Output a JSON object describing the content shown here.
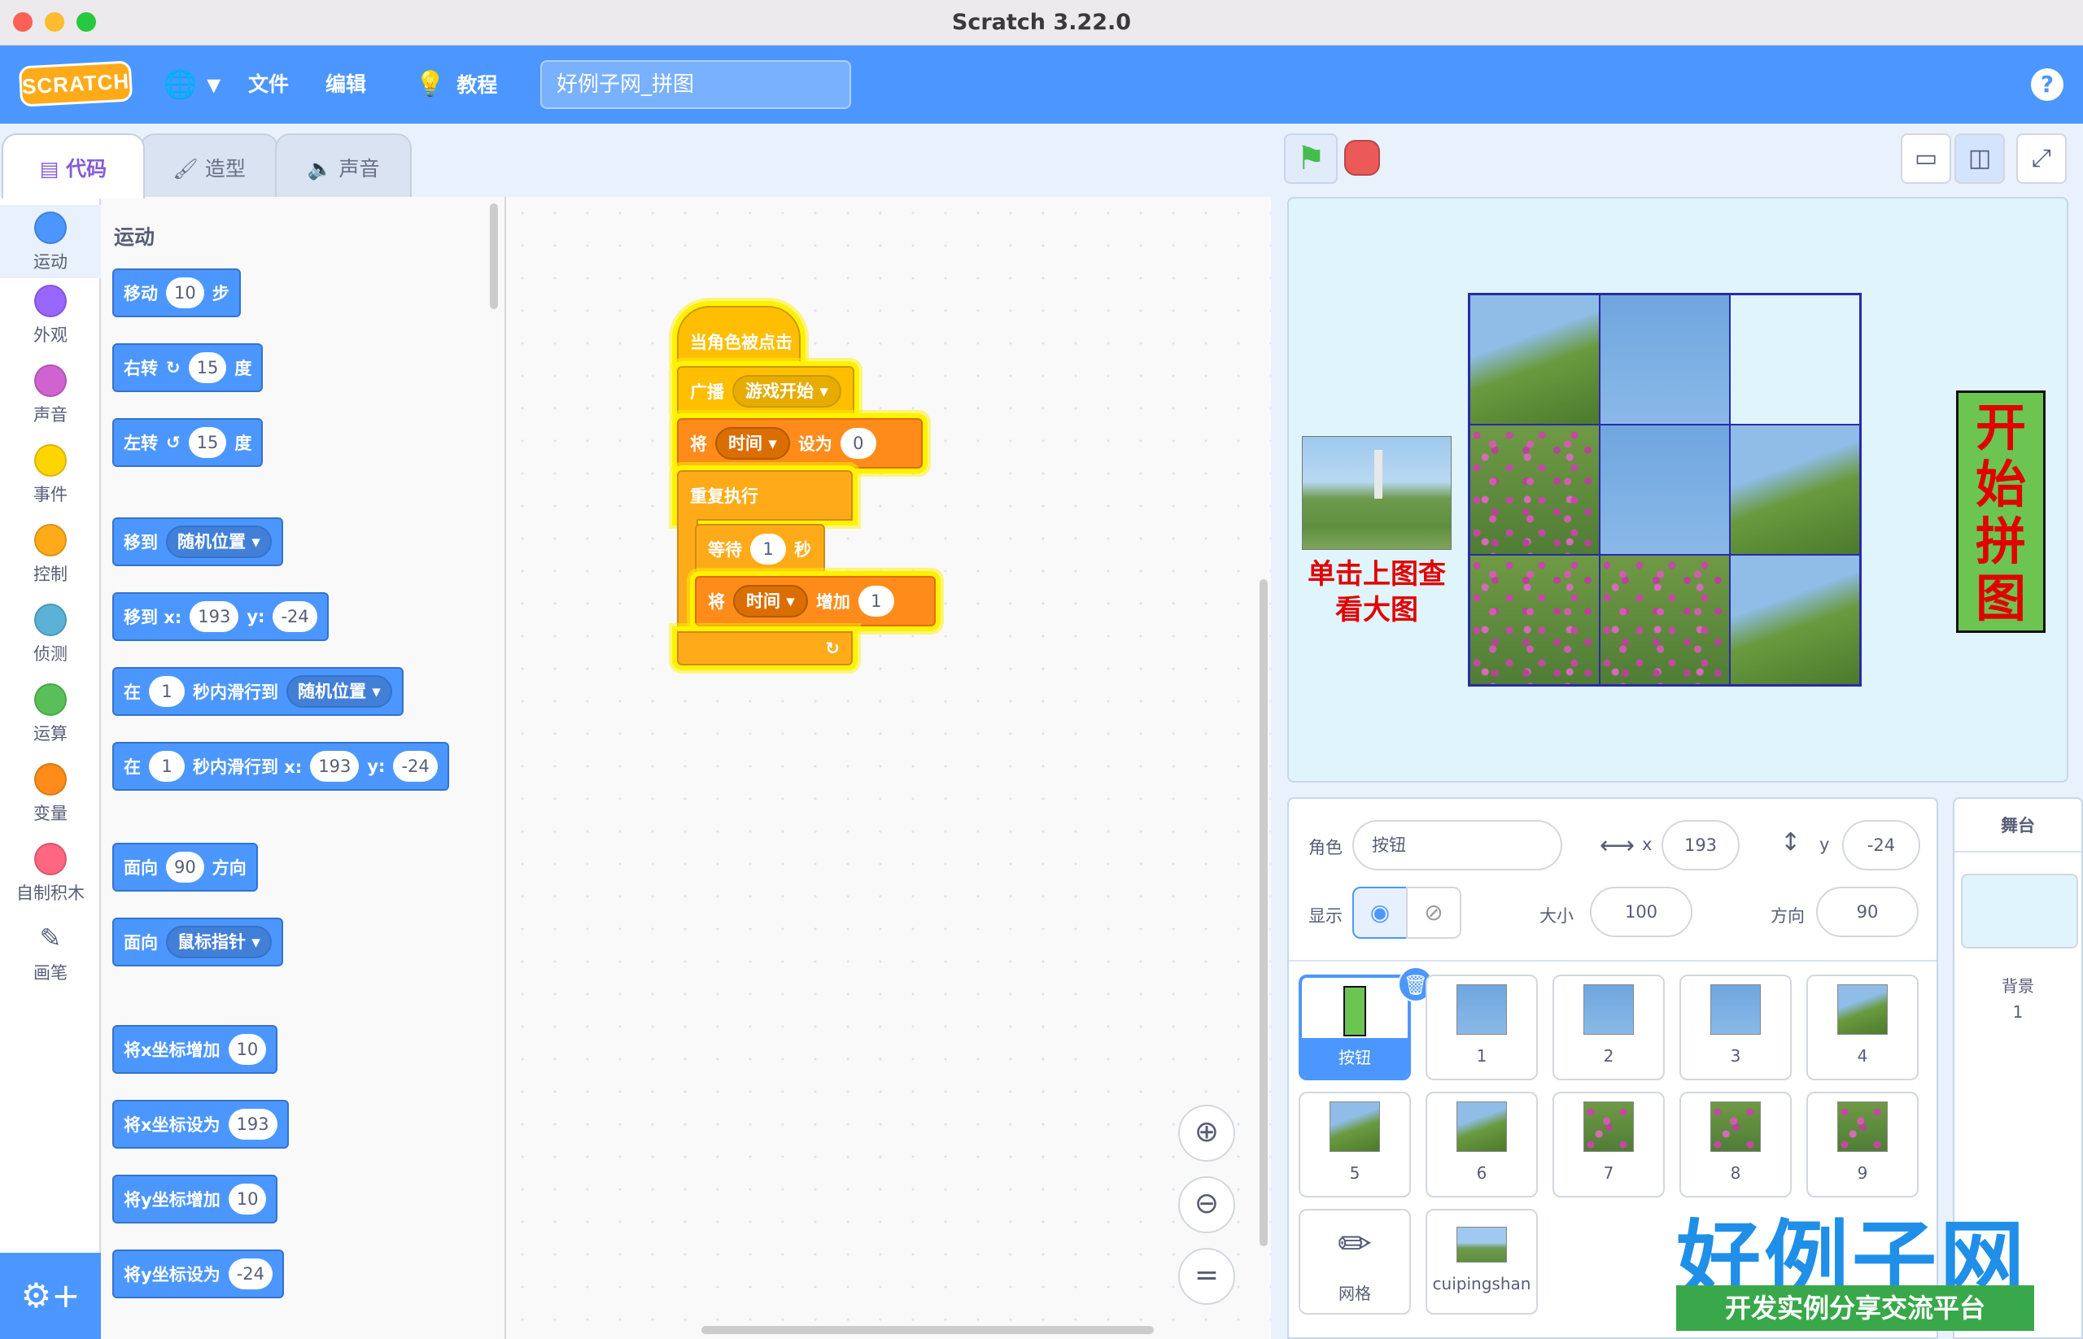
{
  "window": {
    "title": "Scratch 3.22.0"
  },
  "menubar": {
    "logo": "SCRATCH",
    "file": "文件",
    "edit": "编辑",
    "tutorials": "教程",
    "project_title": "好例子网_拼图",
    "help": "?"
  },
  "tabs": [
    {
      "label": "代码",
      "active": true
    },
    {
      "label": "造型",
      "active": false
    },
    {
      "label": "声音",
      "active": false
    }
  ],
  "categories": [
    {
      "label": "运动",
      "color": "#4c97ff"
    },
    {
      "label": "外观",
      "color": "#9966ff"
    },
    {
      "label": "声音",
      "color": "#cf63cf"
    },
    {
      "label": "事件",
      "color": "#ffd500"
    },
    {
      "label": "控制",
      "color": "#ffab19"
    },
    {
      "label": "侦测",
      "color": "#5cb1d6"
    },
    {
      "label": "运算",
      "color": "#59c059"
    },
    {
      "label": "变量",
      "color": "#ff8c1a"
    },
    {
      "label": "自制积木",
      "color": "#ff6680"
    },
    {
      "label": "画笔",
      "color": "#0fbd8c"
    }
  ],
  "palette": {
    "heading": "运动",
    "move": {
      "a": "移动",
      "v": "10",
      "b": "步"
    },
    "turn_right": {
      "a": "右转",
      "v": "15",
      "b": "度"
    },
    "turn_left": {
      "a": "左转",
      "v": "15",
      "b": "度"
    },
    "goto": {
      "a": "移到",
      "d": "随机位置"
    },
    "goto_xy": {
      "a": "移到 x:",
      "x": "193",
      "y_label": "y:",
      "y": "-24"
    },
    "glide": {
      "a": "在",
      "v": "1",
      "b": "秒内滑行到",
      "d": "随机位置"
    },
    "glide_xy": {
      "a": "在",
      "v": "1",
      "b": "秒内滑行到 x:",
      "x": "193",
      "y_label": "y:",
      "y": "-24"
    },
    "point_dir": {
      "a": "面向",
      "v": "90",
      "b": "方向"
    },
    "point_towards": {
      "a": "面向",
      "d": "鼠标指针"
    },
    "change_x": {
      "a": "将x坐标增加",
      "v": "10"
    },
    "set_x": {
      "a": "将x坐标设为",
      "v": "193"
    },
    "change_y": {
      "a": "将y坐标增加",
      "v": "10"
    },
    "set_y": {
      "a": "将y坐标设为",
      "v": "-24"
    }
  },
  "script": {
    "hat": "当角色被点击",
    "broadcast": {
      "a": "广播",
      "d": "游戏开始"
    },
    "setvar": {
      "a": "将",
      "d": "时间",
      "b": "设为",
      "v": "0"
    },
    "forever": "重复执行",
    "wait": {
      "a": "等待",
      "v": "1",
      "b": "秒"
    },
    "changevar": {
      "a": "将",
      "d": "时间",
      "b": "增加",
      "v": "1"
    },
    "loop_icon": "↻"
  },
  "stage": {
    "hint": "单击上图查看大图",
    "start_button": "开始拼图",
    "tiles": [
      "hill",
      "sky",
      "empty",
      "flowers",
      "sky",
      "hill",
      "flowers",
      "flowers",
      "hill"
    ]
  },
  "sprite_info": {
    "sprite_label": "角色",
    "sprite_name": "按钮",
    "x_label": "x",
    "x": "193",
    "y_label": "y",
    "y": "-24",
    "show_label": "显示",
    "size_label": "大小",
    "size": "100",
    "direction_label": "方向",
    "direction": "90"
  },
  "sprites": [
    {
      "name": "按钮",
      "selected": true
    },
    {
      "name": "1"
    },
    {
      "name": "2"
    },
    {
      "name": "3"
    },
    {
      "name": "4"
    },
    {
      "name": "5"
    },
    {
      "name": "6"
    },
    {
      "name": "7"
    },
    {
      "name": "8"
    },
    {
      "name": "9"
    },
    {
      "name": "网格"
    },
    {
      "name": "cuipingshan"
    }
  ],
  "stage_panel": {
    "header": "舞台",
    "backdrop_label": "背景",
    "backdrop_count": "1"
  },
  "watermark": {
    "big": "好例子网",
    "small": "开发实例分享交流平台"
  }
}
